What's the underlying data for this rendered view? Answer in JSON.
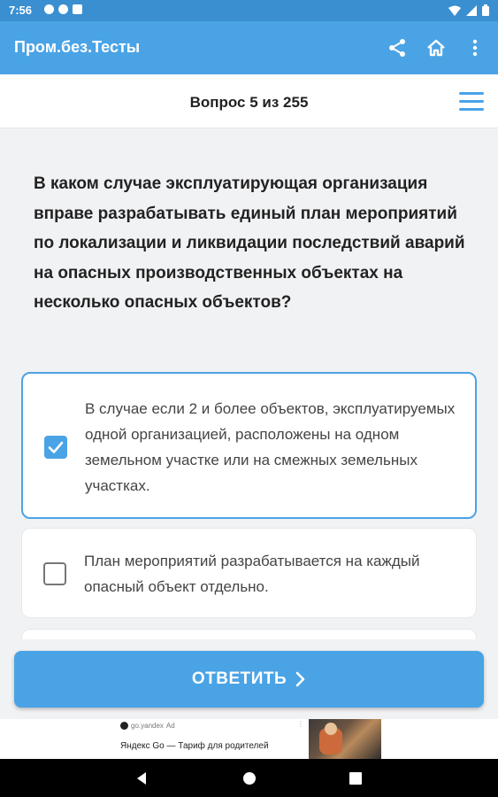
{
  "status_bar": {
    "time": "7:56"
  },
  "app_bar": {
    "title": "Пром.без.Тесты",
    "icons": [
      "share-icon",
      "home-icon",
      "more-vert-icon"
    ]
  },
  "header": {
    "progress": "Вопрос 5 из 255"
  },
  "question": {
    "text": "В каком случае эксплуатирующая организация вправе разрабатывать единый план мероприятий по локализации и ликвидации последствий аварий на опасных производственных объектах на несколько опасных объектов?"
  },
  "options": [
    {
      "text": "В случае если 2 и более объектов, эксплуатируемых одной организацией, расположены на одном земельном участке или на смежных земельных участках.",
      "checked": true
    },
    {
      "text": "План мероприятий разрабатывается на каждый опасный объект отдельно.",
      "checked": false
    }
  ],
  "answer_button": {
    "label": "ОТВЕТИТЬ"
  },
  "ad": {
    "source": "go.yandex",
    "badge": "Ad",
    "text": "Яндекс Go — Тариф для родителей"
  },
  "colors": {
    "accent": "#4aa3e5",
    "status_bar": "#3a8fd0",
    "background": "#f1f2f4"
  }
}
